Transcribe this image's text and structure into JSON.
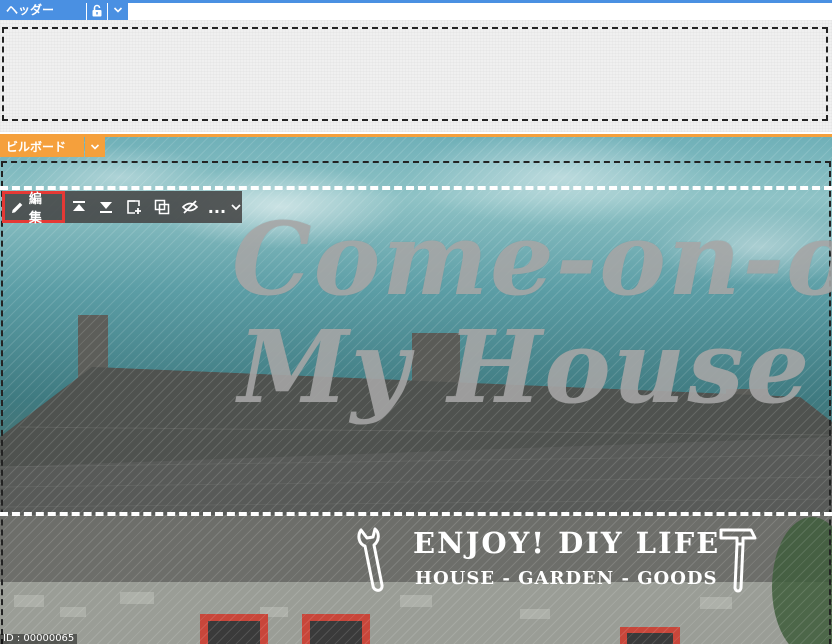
{
  "header": {
    "label": "ヘッダー"
  },
  "billboard": {
    "label": "ビルボード"
  },
  "toolbar": {
    "edit_label": "編集",
    "more_label": "..."
  },
  "hero": {
    "line1": "Come-on-o",
    "line2": "My House"
  },
  "banner": {
    "title": "ENJOY! DIY LIFE",
    "subtitle": "HOUSE - GARDEN - GOODS"
  },
  "status": {
    "text": "ID : 00000065"
  },
  "colors": {
    "header_accent": "#4a90e2",
    "billboard_accent": "#f5a03c",
    "edit_highlight": "#e53935"
  }
}
